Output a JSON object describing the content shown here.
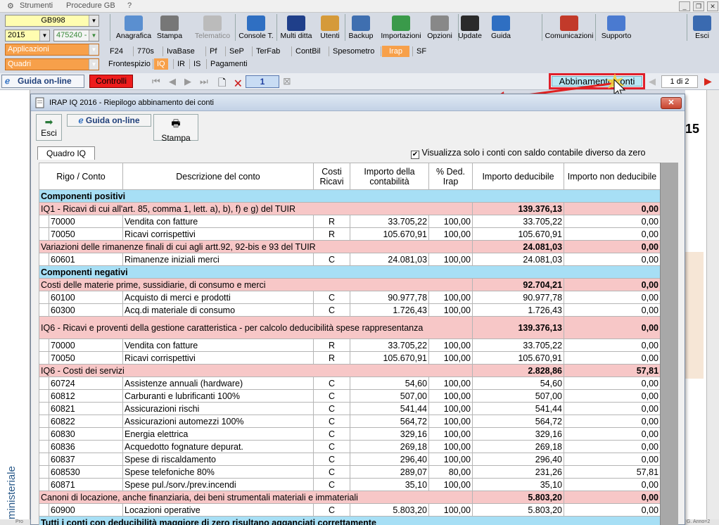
{
  "menubar": {
    "items": [
      "Strumenti",
      "Procedure GB",
      "?"
    ]
  },
  "left": {
    "company": "GB998",
    "year": "2015",
    "code": "475240 -",
    "applicazioni": "Applicazioni",
    "quadri": "Quadri"
  },
  "toolbar": {
    "items": [
      {
        "label": "Anagrafica",
        "icon": "anagrafica-icon",
        "color": "#5a8fd0"
      },
      {
        "label": "Stampa",
        "icon": "printer-icon",
        "color": "#777"
      },
      {
        "label": "Telematico",
        "icon": "telematico-icon",
        "color": "#bbb"
      },
      {
        "label": "Console T.",
        "icon": "console-icon",
        "color": "#2f6fc2"
      },
      {
        "label": "Multi ditta",
        "icon": "multi-ditta-icon",
        "color": "#1f3f8a"
      },
      {
        "label": "Utenti",
        "icon": "users-icon",
        "color": "#d59a3a"
      },
      {
        "label": "Backup",
        "icon": "backup-icon",
        "color": "#3f6fb0"
      },
      {
        "label": "Importazioni",
        "icon": "import-icon",
        "color": "#3a9a4a"
      },
      {
        "label": "Opzioni",
        "icon": "tools-icon",
        "color": "#888"
      },
      {
        "label": "Update",
        "icon": "update-icon",
        "color": "#2a2a2a"
      },
      {
        "label": "Guida",
        "icon": "help-icon",
        "color": "#2f6fc2"
      },
      {
        "label": "Comunicazioni",
        "icon": "comunicazioni-icon",
        "color": "#c23a2a"
      },
      {
        "label": "Supporto",
        "icon": "supporto-icon",
        "color": "#4a7ad0"
      },
      {
        "label": "Esci",
        "icon": "exit-icon",
        "color": "#3a6ab0"
      }
    ]
  },
  "tabs1": [
    "F24",
    "770s",
    "IvaBase",
    "Pf",
    "SeP",
    "TerFab",
    "ContBil",
    "Spesometro",
    "Irap",
    "SF"
  ],
  "tabs2": [
    "Frontespizio",
    "IQ",
    "IR",
    "IS",
    "Pagamenti"
  ],
  "nav": {
    "guida": "Guida on-line",
    "controlli": "Controlli",
    "page": "1",
    "abbinamento": "Abbinamento conti",
    "pagecount": "1 di 2"
  },
  "side": {
    "vertical": "ministeriale",
    "right_fragment": "15",
    "bottom_left": "Pro",
    "bottom_right": "G. Anno=2"
  },
  "dialog": {
    "title": "IRAP IQ 2016 - Riepilogo abbinamento dei conti",
    "esci": "Esci",
    "guida": "Guida on-line",
    "stampa": "Stampa",
    "tab": "Quadro IQ",
    "checkbox": "Visualizza solo i conti con saldo contabile diverso da zero",
    "headers": [
      "Rigo / Conto",
      "Descrizione del conto",
      "Costi Ricavi",
      "Importo della contabilità",
      "% Ded. Irap",
      "Importo deducibile",
      "Importo non deducibile"
    ],
    "rows": [
      {
        "t": "sec",
        "text": "Componenti positivi"
      },
      {
        "t": "grp",
        "text": "IQ1 - Ricavi di cui all'art. 85, comma 1, lett. a), b), f) e g) del TUIR",
        "ded": "139.376,13",
        "nonded": "0,00"
      },
      {
        "t": "row",
        "conto": "70000",
        "desc": "Vendita con fatture",
        "cr": "R",
        "imp": "33.705,22",
        "perc": "100,00",
        "ded": "33.705,22",
        "nonded": "0,00"
      },
      {
        "t": "row",
        "conto": "70050",
        "desc": "Ricavi corrispettivi",
        "cr": "R",
        "imp": "105.670,91",
        "perc": "100,00",
        "ded": "105.670,91",
        "nonded": "0,00"
      },
      {
        "t": "grp",
        "text": "Variazioni delle rimanenze finali di cui agli artt.92, 92-bis e 93 del TUIR",
        "ded": "24.081,03",
        "nonded": "0,00"
      },
      {
        "t": "row",
        "conto": "60601",
        "desc": "Rimanenze iniziali merci",
        "cr": "C",
        "imp": "24.081,03",
        "perc": "100,00",
        "ded": "24.081,03",
        "nonded": "0,00"
      },
      {
        "t": "sec",
        "text": "Componenti negativi"
      },
      {
        "t": "grp",
        "text": "Costi delle materie prime, sussidiarie, di consumo e merci",
        "ded": "92.704,21",
        "nonded": "0,00"
      },
      {
        "t": "row",
        "conto": "60100",
        "desc": "Acquisto di merci e prodotti",
        "cr": "C",
        "imp": "90.977,78",
        "perc": "100,00",
        "ded": "90.977,78",
        "nonded": "0,00"
      },
      {
        "t": "row",
        "conto": "60300",
        "desc": "Acq.di materiale di consumo",
        "cr": "C",
        "imp": "1.726,43",
        "perc": "100,00",
        "ded": "1.726,43",
        "nonded": "0,00"
      },
      {
        "t": "grp2",
        "text": "IQ6 - Ricavi e proventi della gestione caratteristica - per calcolo deducibilità spese rappresentanza",
        "ded": "139.376,13",
        "nonded": "0,00"
      },
      {
        "t": "row",
        "conto": "70000",
        "desc": "Vendita con fatture",
        "cr": "R",
        "imp": "33.705,22",
        "perc": "100,00",
        "ded": "33.705,22",
        "nonded": "0,00"
      },
      {
        "t": "row",
        "conto": "70050",
        "desc": "Ricavi corrispettivi",
        "cr": "R",
        "imp": "105.670,91",
        "perc": "100,00",
        "ded": "105.670,91",
        "nonded": "0,00"
      },
      {
        "t": "grp",
        "text": "IQ6 - Costi dei servizi",
        "ded": "2.828,86",
        "nonded": "57,81"
      },
      {
        "t": "row",
        "conto": "60724",
        "desc": "Assistenze annuali (hardware)",
        "cr": "C",
        "imp": "54,60",
        "perc": "100,00",
        "ded": "54,60",
        "nonded": "0,00"
      },
      {
        "t": "row",
        "conto": "60812",
        "desc": "Carburanti e lubrificanti 100%",
        "cr": "C",
        "imp": "507,00",
        "perc": "100,00",
        "ded": "507,00",
        "nonded": "0,00"
      },
      {
        "t": "row",
        "conto": "60821",
        "desc": "Assicurazioni rischi",
        "cr": "C",
        "imp": "541,44",
        "perc": "100,00",
        "ded": "541,44",
        "nonded": "0,00"
      },
      {
        "t": "row",
        "conto": "60822",
        "desc": "Assicurazioni automezzi 100%",
        "cr": "C",
        "imp": "564,72",
        "perc": "100,00",
        "ded": "564,72",
        "nonded": "0,00"
      },
      {
        "t": "row",
        "conto": "60830",
        "desc": "Energia elettrica",
        "cr": "C",
        "imp": "329,16",
        "perc": "100,00",
        "ded": "329,16",
        "nonded": "0,00"
      },
      {
        "t": "row",
        "conto": "60836",
        "desc": "Acquedotto fognature depurat.",
        "cr": "C",
        "imp": "269,18",
        "perc": "100,00",
        "ded": "269,18",
        "nonded": "0,00"
      },
      {
        "t": "row",
        "conto": "60837",
        "desc": "Spese di riscaldamento",
        "cr": "C",
        "imp": "296,40",
        "perc": "100,00",
        "ded": "296,40",
        "nonded": "0,00"
      },
      {
        "t": "row",
        "conto": "608530",
        "desc": "Spese telefoniche 80%",
        "cr": "C",
        "imp": "289,07",
        "perc": "80,00",
        "ded": "231,26",
        "nonded": "57,81"
      },
      {
        "t": "row",
        "conto": "60871",
        "desc": "Spese pul./sorv./prev.incendi",
        "cr": "C",
        "imp": "35,10",
        "perc": "100,00",
        "ded": "35,10",
        "nonded": "0,00"
      },
      {
        "t": "grp",
        "text": "Canoni di locazione, anche finanziaria, dei beni strumentali materiali e immateriali",
        "ded": "5.803,20",
        "nonded": "0,00"
      },
      {
        "t": "row",
        "conto": "60900",
        "desc": "Locazioni operative",
        "cr": "C",
        "imp": "5.803,20",
        "perc": "100,00",
        "ded": "5.803,20",
        "nonded": "0,00"
      },
      {
        "t": "sec",
        "text": "Tutti i conti con deducibilità maggiore di zero risultano agganciati correttamente"
      }
    ]
  },
  "colors": {
    "orange": "#f7a04a",
    "section": "#a7dff5",
    "group": "#f7c7c7",
    "highlight_border": "#e0202a"
  }
}
